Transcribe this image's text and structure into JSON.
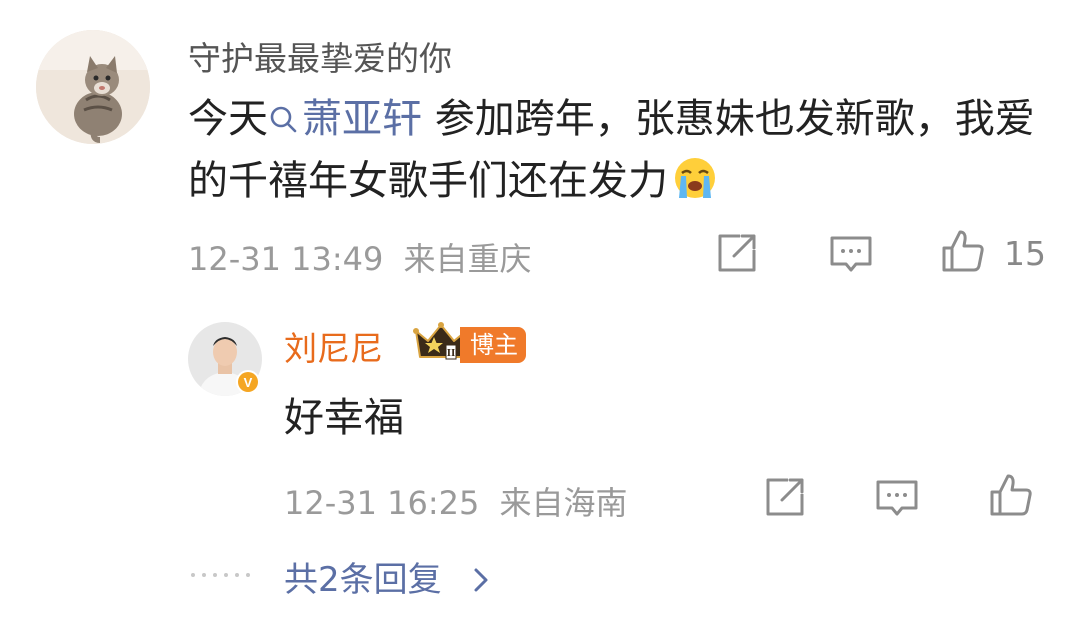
{
  "comment": {
    "username": "守护最最挚爱的你",
    "text_before": "今天",
    "topic": "萧亚轩",
    "text_after": " 参加跨年，张惠妹也发新歌，我爱的千禧年女歌手们还在发力",
    "emoji_icon": "crying-face-icon",
    "time": "12-31 13:49",
    "location": "来自重庆",
    "like_count": "15"
  },
  "reply": {
    "username": "刘尼尼",
    "badge": "博主",
    "text": "好幸福",
    "time": "12-31 16:25",
    "location": "来自海南"
  },
  "more_replies": {
    "label": "共2条回复"
  },
  "colors": {
    "link": "#5b6fa5",
    "reply_name": "#e86b1c",
    "badge_bg": "#f07a2a",
    "meta": "#9a9a9a"
  }
}
